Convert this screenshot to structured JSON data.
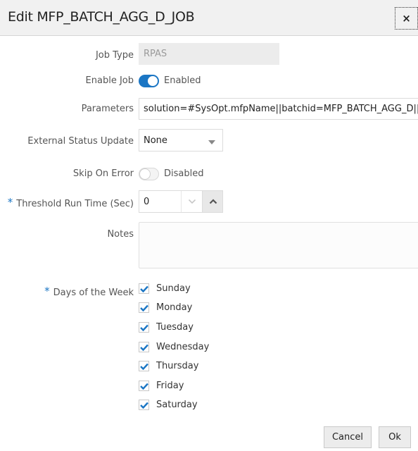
{
  "dialog": {
    "title": "Edit MFP_BATCH_AGG_D_JOB",
    "close_icon": "×"
  },
  "form": {
    "job_type": {
      "label": "Job Type",
      "value": "RPAS"
    },
    "enable_job": {
      "label": "Enable Job",
      "state": true,
      "state_text": "Enabled"
    },
    "parameters": {
      "label": "Parameters",
      "value": "solution=#SysOpt.mfpName||batchid=MFP_BATCH_AGG_D||log"
    },
    "external_status_update": {
      "label": "External Status Update",
      "value": "None"
    },
    "skip_on_error": {
      "label": "Skip On Error",
      "state": false,
      "state_text": "Disabled"
    },
    "threshold_run_time": {
      "label": "Threshold Run Time (Sec)",
      "required_marker": "*",
      "value": "0"
    },
    "notes": {
      "label": "Notes",
      "value": ""
    },
    "days_of_week": {
      "label": "Days of the Week",
      "required_marker": "*",
      "days": [
        {
          "label": "Sunday",
          "checked": true
        },
        {
          "label": "Monday",
          "checked": true
        },
        {
          "label": "Tuesday",
          "checked": true
        },
        {
          "label": "Wednesday",
          "checked": true
        },
        {
          "label": "Thursday",
          "checked": true
        },
        {
          "label": "Friday",
          "checked": true
        },
        {
          "label": "Saturday",
          "checked": true
        }
      ]
    }
  },
  "footer": {
    "cancel_label": "Cancel",
    "ok_label": "Ok"
  },
  "colors": {
    "accent": "#1b76c4",
    "header_bg": "#f1f1f1"
  }
}
